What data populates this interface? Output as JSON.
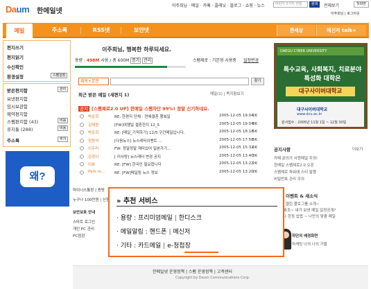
{
  "brand": {
    "logo_a": "Da",
    "logo_b": "um",
    "service": "한메일넷"
  },
  "topbar": {
    "links": "이주희님 · 메일 · 카페 · 플래닛 · 블로그 · 쇼핑 · 뉴스",
    "search_placeholder": "어린이 5가지 연습",
    "search_button": "검색",
    "all_view": "전체보기",
    "home_button": "첫화면",
    "user_info": "이주희님 | 로그아웃"
  },
  "nav": {
    "tabs": [
      "메일",
      "주소록",
      "RSS넷",
      "보안넷"
    ],
    "right": [
      "편세상",
      "메신저 talk+"
    ]
  },
  "sidebar": {
    "write": "편지쓰기",
    "read": "편지읽기",
    "self_write": "수신확인",
    "env": "환경설정",
    "env_button": "스팸설정",
    "inbox": "받은편지함",
    "manage_button": "관리",
    "sent": "보낸편지함",
    "temp": "임시보관함",
    "reserved": "예약편지함",
    "spam": "스팸편지함 (43)",
    "spam_button": "비움",
    "trash": "휴지통 (288)",
    "trash_button": "비움",
    "address": "주소록",
    "address_button": "추가",
    "ad_text": "왜?",
    "bottom1": "마이너스통장 | 증빙",
    "bottom2": "누구나 100만원 | 신청",
    "bottom3": "보안보호 안내",
    "bottom4": "스마트 로그인",
    "bottom5": "개인 PC 관리",
    "bottom6": "PC점검"
  },
  "main": {
    "greeting": "이주희님, 행복한 하루되세요.",
    "usage_label": "용량 :",
    "usage_used": "498M",
    "usage_text": "사용 / 총 600M",
    "usage_add": "증가",
    "usage_manage": "관리",
    "usage_fraction": 0.83,
    "spam_filter": "스팸제로 : 기본형 사용중",
    "spam_filter_link": "설정변경",
    "search_select": "제목+본문",
    "search_button": "찾기",
    "recent_title": "최근 받은 메일 (새편지 1)",
    "recent_right": "메일(1) | 쪽지함보기",
    "notice_tag": "공지",
    "notice": "[스팸제로2.0 UP] 한메일 스팸차단 99%! 정말 신기하네요.",
    "mails": [
      {
        "sender": "박준희",
        "subject": "RE: 한편지 단체 - 연애결혼 행복일",
        "date": "2005-12-05 19:04",
        "size": "2K"
      },
      {
        "sender": "김재원",
        "subject": "[FW]여행일 결혼한지 12_5",
        "date": "2005-12-05 19:04",
        "size": "8K"
      },
      {
        "sender": "박준희",
        "subject": "RE: [메일_기적하기] 12/5 구간메일입니다.",
        "date": "2005-12-05 18:18",
        "size": "5K"
      },
      {
        "sender": "정원석",
        "subject": "[다음뉴스] 뉴스레터이벤트 ...",
        "date": "2005-12-05 17:58",
        "size": "5K"
      },
      {
        "sender": "이우리",
        "subject": "FW: 정말정말 재미있어 일본가기...",
        "date": "2005-12-05 15:32",
        "size": "6K"
      },
      {
        "sender": "김경이",
        "subject": "[ 미사랑] 뉴스레터 변경 공지",
        "date": "2005-12-05 13:40",
        "size": "3K"
      },
      {
        "sender": "이효",
        "subject": "RE: [FW] 한국인 필요합니다",
        "date": "2005-12-05 13:22",
        "size": "2K"
      },
      {
        "sender": "Park ro...",
        "subject": "RE: [FW]메일링 뉴스 정보",
        "date": "2005-12-05 13:20",
        "size": "2K"
      }
    ]
  },
  "right": {
    "banner_header": "DAEGU CYBER UNIVERSITY",
    "banner_line1": "특수교육, 사회복지, 치료분야",
    "banner_line2": "특성화 대학은",
    "banner_cta": "대구사이버대학교",
    "banner_univ": "대구사이버대학교",
    "banner_url": "www.dcu.ac.kr",
    "banner_date": "원서접수 : 2005년 11월 1일 ~ 12월 30일",
    "notice_title": "공지사항",
    "notice_more": "더보기",
    "notices": [
      "카페 문의가 사원메일 주의!",
      "한메일 스팸제로2.0 오픈",
      "스팸제로 파워에 스티 발행",
      "비밀번호 관리 주의"
    ],
    "event_title": "이벤트 & 새소식",
    "events": [
      "열린 플로그를 소개~",
      "북호조~ 내가 보낸 메일 일정공개?",
      "나 한정 섭렵 ~ 나만의 맞춤 메일"
    ],
    "skin_title": "하단의 배경화면",
    "skin_desc": "마케팅 나의 나의 가블"
  },
  "popup": {
    "title": "» 추천 서비스",
    "row1_label": "· 용량 : ",
    "row1_a": "프리미엄메일",
    "row1_b": "한디스크",
    "row2_label": "· 메일알림 : ",
    "row2_a": "핸드폰",
    "row2_b": "메신저",
    "row3_label": "· 기타 : ",
    "row3_a": "카드메일",
    "row3_b": "e-청첩장"
  },
  "footer": {
    "links": "한메일넷 운영정책  |  스팸 운영정책  |  고객센터",
    "copyright": "Copyright by Daum Communications Corp."
  }
}
